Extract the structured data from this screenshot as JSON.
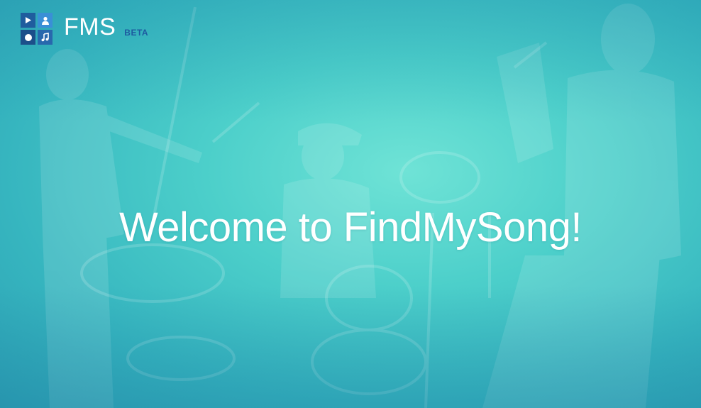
{
  "brand": {
    "name": "FMS",
    "badge": "BETA",
    "logo_icons": [
      "play-icon",
      "user-icon",
      "record-icon",
      "music-note-icon"
    ]
  },
  "hero": {
    "heading": "Welcome to FindMySong!",
    "background": "band-photo",
    "tint": "#4ccfca"
  },
  "colors": {
    "logo_dark": "#1f5d9e",
    "logo_light": "#3a8fd6",
    "badge": "#1d5aa0",
    "text": "#ffffff"
  }
}
